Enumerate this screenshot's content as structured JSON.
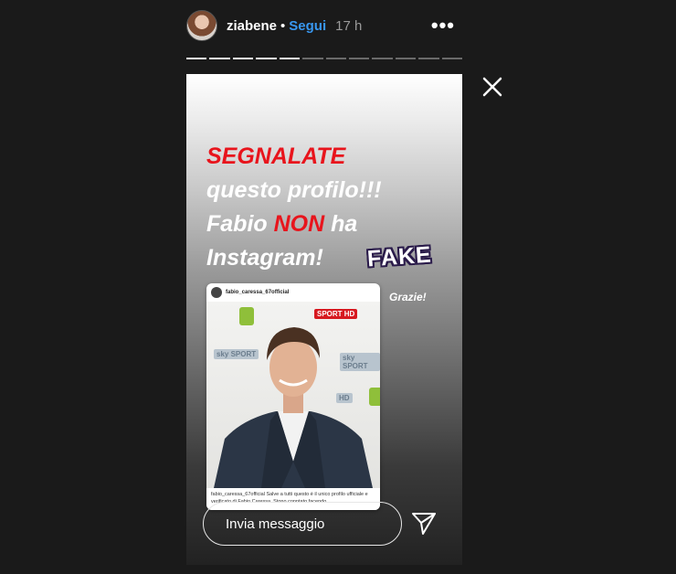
{
  "header": {
    "username": "ziabene",
    "separator": "•",
    "follow_label": "Segui",
    "time": "17 h",
    "more_icon": "more-horizontal-icon"
  },
  "progress": {
    "segments": 12,
    "seen": 5
  },
  "close_icon": "close-icon",
  "story": {
    "line1_red": "SEGNALATE",
    "line2": "questo profilo!!!",
    "line3_a": "Fabio ",
    "line3_red": "NON",
    "line3_b": " ha",
    "line4": "Instagram!",
    "sticker": "FAKE",
    "thanks": "Grazie!"
  },
  "post": {
    "username": "fabio_caressa_67official",
    "caption": "fabio_caressa_67official Salve a tutti questo è il unico profilo ufficiale e verificato di Fabio Caressa. Stono conntato facendo...",
    "logos": {
      "sport_hd": "SPORT HD",
      "sky_sport": "sky SPORT",
      "sky_sport_2": "sky SPORT",
      "hd": "HD"
    }
  },
  "reply": {
    "placeholder": "Invia messaggio"
  },
  "send_icon": "send-icon",
  "colors": {
    "accent": "#3897f0",
    "headline_red": "#e8141c",
    "background": "#1a1a1a"
  }
}
